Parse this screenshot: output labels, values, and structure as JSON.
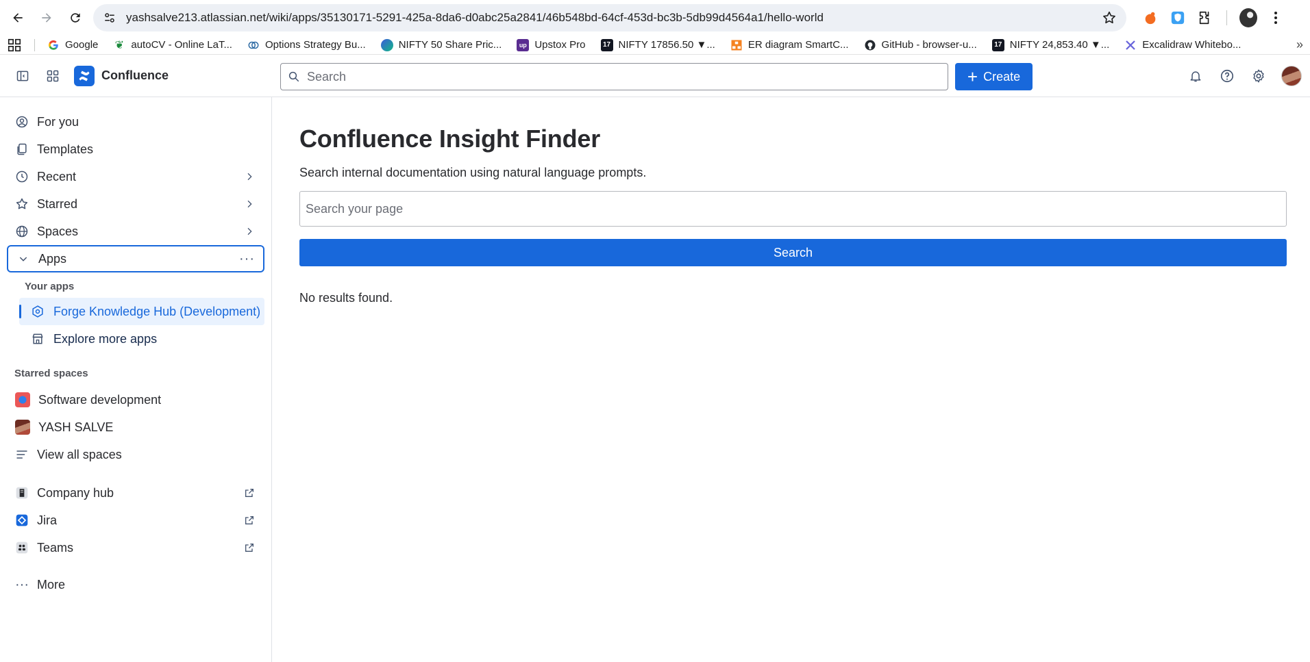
{
  "browser": {
    "url": "yashsalve213.atlassian.net/wiki/apps/35130171-5291-425a-8da6-d0abc25a2841/46b548bd-64cf-453d-bc3b-5db99d4564a1/hello-world",
    "bookmarks": [
      {
        "label": "Google",
        "icon": "google-icon",
        "color": "#ffffff"
      },
      {
        "label": "autoCV - Online LaT...",
        "icon": "leaf-icon",
        "color": "#1b8a3c"
      },
      {
        "label": "Options Strategy Bu...",
        "icon": "options-icon",
        "color": "#2d6aa3"
      },
      {
        "label": "NIFTY 50 Share Pric...",
        "icon": "nifty-icon",
        "color": "#3aa"
      },
      {
        "label": "Upstox Pro",
        "icon": "upstox-icon",
        "color": "#5a2d91"
      },
      {
        "label": "NIFTY 17856.50 ▼...",
        "icon": "tradingview-icon",
        "color": "#131722"
      },
      {
        "label": "ER diagram SmartC...",
        "icon": "smartdraw-icon",
        "color": "#f58220"
      },
      {
        "label": "GitHub - browser-u...",
        "icon": "github-icon",
        "color": "#24292f"
      },
      {
        "label": "NIFTY 24,853.40 ▼...",
        "icon": "tradingview-icon",
        "color": "#131722"
      },
      {
        "label": "Excalidraw Whitebo...",
        "icon": "excalidraw-icon",
        "color": "#6965db"
      }
    ]
  },
  "topnav": {
    "brand": "Confluence",
    "search_placeholder": "Search",
    "create_label": "Create"
  },
  "sidebar": {
    "items": [
      {
        "label": "For you",
        "icon": "user-circle-icon"
      },
      {
        "label": "Templates",
        "icon": "templates-icon"
      },
      {
        "label": "Recent",
        "icon": "clock-icon"
      },
      {
        "label": "Starred",
        "icon": "star-icon"
      },
      {
        "label": "Spaces",
        "icon": "globe-icon"
      }
    ],
    "apps_label": "Apps",
    "your_apps_label": "Your apps",
    "apps": [
      {
        "label": "Forge Knowledge Hub (Development)"
      },
      {
        "label": "Explore more apps"
      }
    ],
    "starred_spaces_label": "Starred spaces",
    "spaces": [
      {
        "label": "Software development"
      },
      {
        "label": "YASH SALVE"
      }
    ],
    "view_all_spaces": "View all spaces",
    "external": [
      {
        "label": "Company hub"
      },
      {
        "label": "Jira"
      },
      {
        "label": "Teams"
      }
    ],
    "more_label": "More"
  },
  "main": {
    "title": "Confluence Insight Finder",
    "description": "Search internal documentation using natural language prompts.",
    "search_placeholder": "Search your page",
    "search_button": "Search",
    "results_text": "No results found."
  },
  "colors": {
    "brand_blue": "#1868db",
    "active_bg": "#e9f2fe"
  }
}
